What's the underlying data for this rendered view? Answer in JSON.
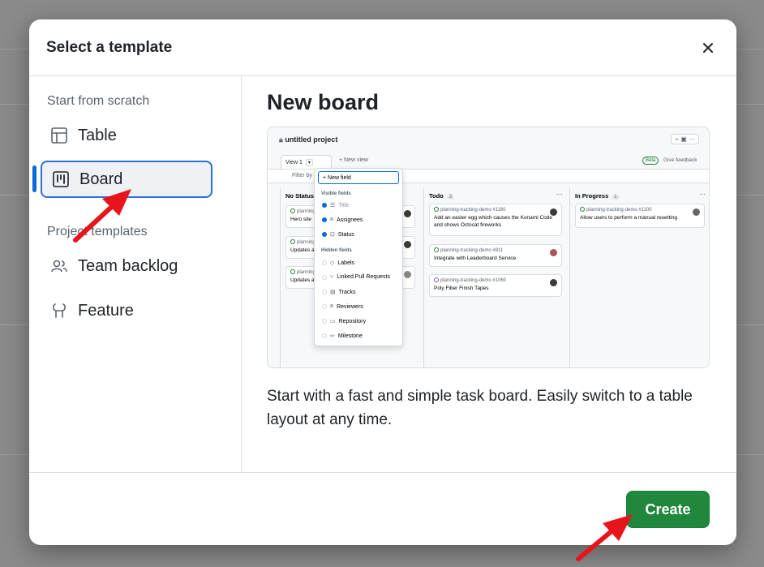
{
  "dialog": {
    "title": "Select a template",
    "close_label": "×"
  },
  "sidebar": {
    "scratch_label": "Start from scratch",
    "templates_label": "Project templates",
    "items": [
      {
        "label": "Table",
        "icon": "table-icon"
      },
      {
        "label": "Board",
        "icon": "board-icon",
        "selected": true
      },
      {
        "label": "Team backlog",
        "icon": "people-icon"
      },
      {
        "label": "Feature",
        "icon": "feature-icon"
      }
    ]
  },
  "main": {
    "title": "New board",
    "description": "Start with a fast and simple task board. Easily switch to a table layout at any time."
  },
  "preview": {
    "project_title": "untitled project",
    "view_tab": "View 1",
    "new_view": "+ New view",
    "beta": "Beta",
    "feedback": "Give feedback",
    "filter": "Filter by",
    "dropdown": {
      "new_field": "+ New field",
      "visible_label": "Visible fields",
      "visible": [
        "Title",
        "Assignees",
        "Status"
      ],
      "hidden_label": "Hidden fields",
      "hidden": [
        "Labels",
        "Linked Pull Requests",
        "Tracks",
        "Reviewers",
        "Repository",
        "Milestone"
      ]
    },
    "columns": [
      {
        "name": "No Status",
        "cards": [
          {
            "ref": "planning",
            "text": "Hero site"
          },
          {
            "ref": "planning",
            "text": "Updates a"
          },
          {
            "ref": "planning",
            "text": "Updates a"
          }
        ]
      },
      {
        "name": "Todo",
        "count": "3",
        "cards": [
          {
            "ref": "planning-tracking-demo #1180",
            "text": "Add an easter egg which causes the Konami Code and shows Octocat fireworks"
          },
          {
            "ref": "planning-tracking-demo #811",
            "text": "Integrate with Leaderboard Service"
          },
          {
            "ref": "planning-tracking-demo #1060",
            "text": "Poly Fiber Finish Tapes"
          }
        ]
      },
      {
        "name": "In Progress",
        "count": "1",
        "cards": [
          {
            "ref": "planning-tracking-demo #1100",
            "text": "Allow users to perform a manual resetting"
          }
        ]
      }
    ]
  },
  "footer": {
    "create_label": "Create"
  },
  "colors": {
    "primary": "#1f883d",
    "selection": "#2f6fd6",
    "annotation_arrow": "#e8141c"
  }
}
